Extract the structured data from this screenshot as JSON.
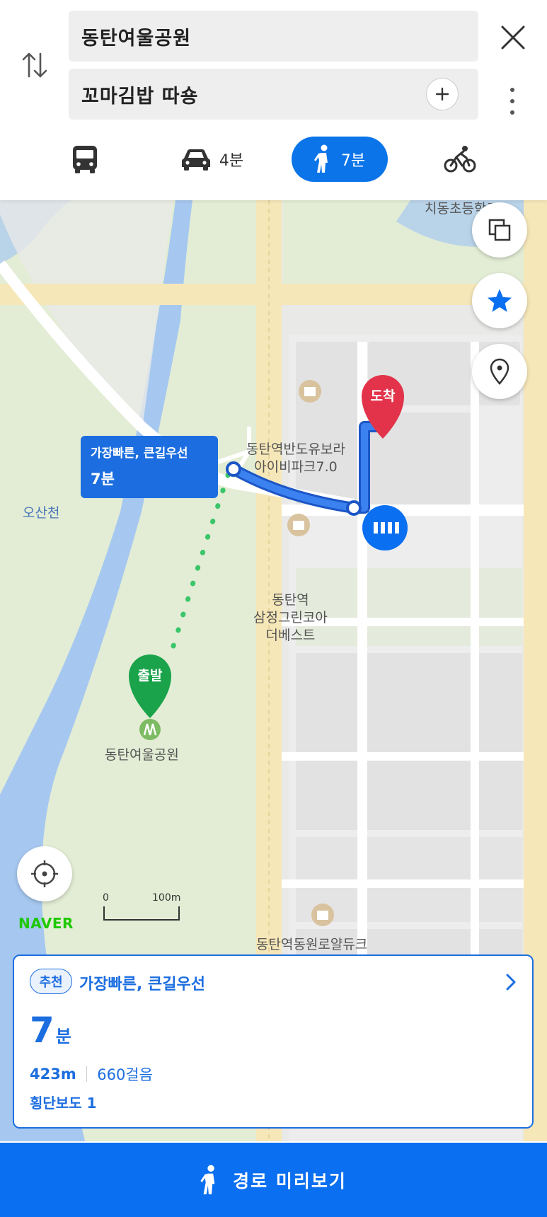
{
  "search": {
    "origin": "동탄여울공원",
    "destination": "꼬마김밥 따숑"
  },
  "modes": [
    {
      "name": "bus",
      "time": ""
    },
    {
      "name": "car",
      "time": "4분"
    },
    {
      "name": "walk",
      "time": "7분",
      "selected": true
    },
    {
      "name": "bike",
      "time": ""
    }
  ],
  "map": {
    "labels": {
      "school": "치동초등학교",
      "apt1_line1": "동탄역반도유보라",
      "apt1_line2": "아이비파크7.0",
      "apt2_line1": "동탄역",
      "apt2_line2": "삼정그린코아",
      "apt2_line3": "더베스트",
      "river": "오산천",
      "park": "동탄여울공원",
      "apt3": "동탄역동원로얄듀크"
    },
    "callout_title": "가장빠른, 큰길우선",
    "callout_time": "7분",
    "start_pin": "출발",
    "end_pin": "도착",
    "logo": "NAVER",
    "scale_start": "0",
    "scale_end": "100m"
  },
  "route_card": {
    "badge": "추천",
    "title": "가장빠른, 큰길우선",
    "time_value": "7",
    "time_unit": "분",
    "distance": "423m",
    "steps": "660걸음",
    "crosswalk": "횡단보도 1"
  },
  "bottom_bar": {
    "label": "경로 미리보기"
  },
  "colors": {
    "accent": "#0a74e8",
    "route": "#1c6ee0",
    "start_pin": "#1aa34a",
    "end_pin": "#e2334a"
  }
}
